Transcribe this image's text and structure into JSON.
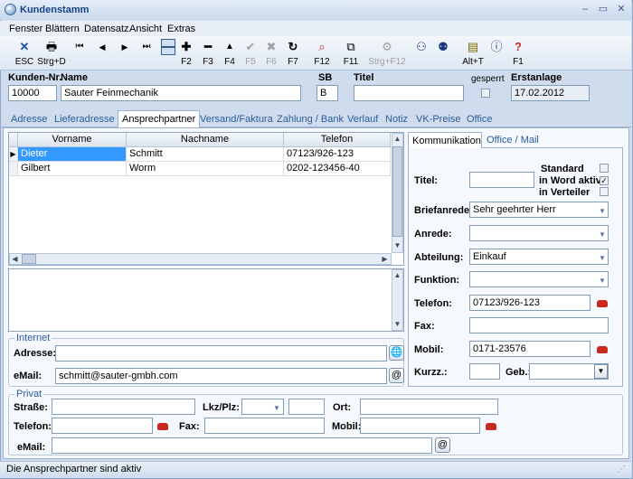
{
  "window": {
    "title": "Kundenstamm"
  },
  "menu": [
    "Fenster",
    "Blättern",
    "Datensatz",
    "Ansicht",
    "Extras"
  ],
  "toolbar": {
    "esc_label": "ESC",
    "strg_d_label": "Strg+D",
    "f2": "F2",
    "f3": "F3",
    "f4": "F4",
    "f5": "F5",
    "f6": "F6",
    "f7": "F7",
    "f12": "F12",
    "f11": "F11",
    "strg_f12": "Strg+F12",
    "alt_t": "Alt+T",
    "f1": "F1"
  },
  "header": {
    "kundennr_label": "Kunden-Nr.",
    "kundennr": "10000",
    "name_label": "Name",
    "name": "Sauter Feinmechanik",
    "sb_label": "SB",
    "sb": "B",
    "titel_label": "Titel",
    "titel": "",
    "gesperrt_label": "gesperrt",
    "erstanlage_label": "Erstanlage",
    "erstanlage": "17.02.2012"
  },
  "tabs": [
    "Adresse",
    "Lieferadresse",
    "Ansprechpartner",
    "Versand/Faktura",
    "Zahlung / Bank",
    "Verlauf",
    "Notiz",
    "VK-Preise",
    "Office"
  ],
  "grid": {
    "columns": [
      "Vorname",
      "Nachname",
      "Telefon"
    ],
    "rows": [
      [
        "Dieter",
        "Schmitt",
        "07123/926-123"
      ],
      [
        "Gilbert",
        "Worm",
        "0202-123456-40"
      ]
    ]
  },
  "internet": {
    "group_label": "Internet",
    "adresse_label": "Adresse:",
    "adresse": "",
    "email_label": "eMail:",
    "email": "schmitt@sauter-gmbh.com"
  },
  "privat": {
    "group_label": "Privat",
    "strasse_label": "Straße:",
    "lkz_label": "Lkz/Plz:",
    "ort_label": "Ort:",
    "telefon_label": "Telefon:",
    "fax_label": "Fax:",
    "mobil_label": "Mobil:",
    "email_label": "eMail:"
  },
  "detail": {
    "tab_kommunikation": "Kommunikation",
    "tab_office": "Office / Mail",
    "titel_label": "Titel:",
    "titel": "",
    "standard_label": "Standard",
    "word_label": "in Word aktiv",
    "verteiler_label": "in Verteiler",
    "briefanrede_label": "Briefanrede:",
    "briefanrede": "Sehr geehrter Herr",
    "anrede_label": "Anrede:",
    "anrede": "",
    "abteilung_label": "Abteilung:",
    "abteilung": "Einkauf",
    "funktion_label": "Funktion:",
    "funktion": "",
    "telefon_label": "Telefon:",
    "telefon": "07123/926-123",
    "fax_label": "Fax:",
    "fax": "",
    "mobil_label": "Mobil:",
    "mobil": "0171-23576",
    "kurzz_label": "Kurzz.:",
    "kurzz": "",
    "geb_label": "Geb.:",
    "geb": ""
  },
  "status": {
    "text": "Die Ansprechpartner sind aktiv"
  }
}
